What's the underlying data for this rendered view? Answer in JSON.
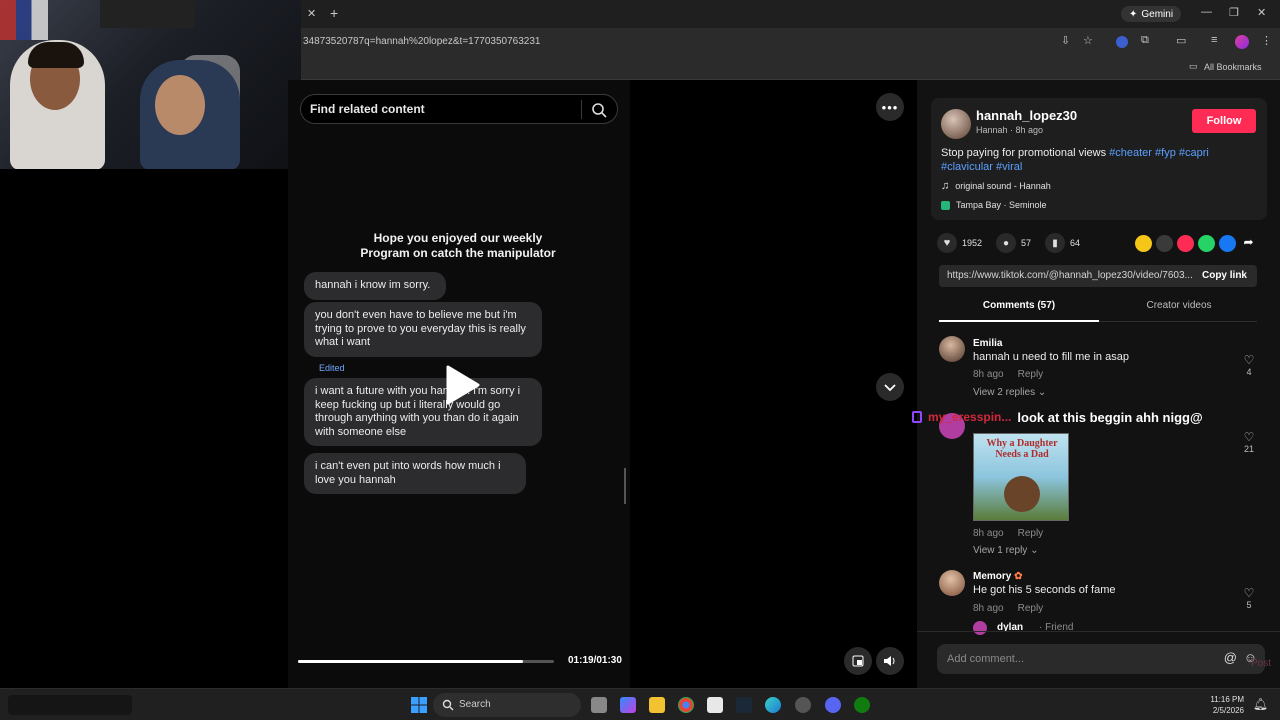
{
  "browser": {
    "url": "34873520787q=hannah%20lopez&t=1770350763231",
    "gemini_label": "Gemini",
    "bookmarks_label": "All Bookmarks"
  },
  "search": {
    "placeholder": "Find related content"
  },
  "video": {
    "title_line1": "Hope you enjoyed our weekly",
    "title_line2": "Program on catch the manipulator",
    "messages": [
      "hannah i know im sorry.",
      "you don't even have to believe me but i'm trying to prove to you everyday this is really what i want",
      "i want a future with you hannah. i'm sorry i keep fucking up but i literally would go through anything with you than do it again with someone else",
      "i can't even put into words how much i love you hannah"
    ],
    "edited_label": "Edited",
    "progress": 0.88,
    "time": "01:19/01:30"
  },
  "post": {
    "username": "hannah_lopez30",
    "display_meta": "Hannah · 8h ago",
    "follow_label": "Follow",
    "caption": "Stop paying for promotional views",
    "hashtags": [
      "#cheater",
      "#fyp",
      "#capri",
      "#clavicular",
      "#viral"
    ],
    "sound": "original sound - Hannah",
    "location": "Tampa Bay · Seminole",
    "likes": "1952",
    "comments": "57",
    "saves": "64",
    "link": "https://www.tiktok.com/@hannah_lopez30/video/7603...",
    "copy_link_label": "Copy link",
    "tab_comments": "Comments (57)",
    "tab_creator": "Creator videos"
  },
  "comments": [
    {
      "name": "Emilia",
      "text": "hannah u need to fill me in asap",
      "time": "8h ago",
      "reply": "Reply",
      "likes": "4",
      "replies": "View 2 replies"
    },
    {
      "name": "",
      "text": "",
      "time": "8h ago",
      "reply": "Reply",
      "likes": "21",
      "replies": "View 1 reply",
      "image_title": "Why a Daughter Needs a Dad"
    },
    {
      "name": "Memory",
      "text": "He got his 5 seconds of fame",
      "time": "8h ago",
      "reply": "Reply",
      "likes": "5"
    },
    {
      "name": "dylan",
      "friend": "· Friend"
    }
  ],
  "comment_input": {
    "placeholder": "Add comment...",
    "post_label": "Post"
  },
  "stream_chat": {
    "user": "my_eresspin...",
    "message": "look at this beggin ahh nigg@"
  },
  "taskbar": {
    "search_label": "Search",
    "time": "11:16 PM",
    "date": "2/5/2026"
  },
  "colors": {
    "accent": "#fe2c55",
    "hashtag": "#5ba0ff",
    "bg": "#000000"
  }
}
